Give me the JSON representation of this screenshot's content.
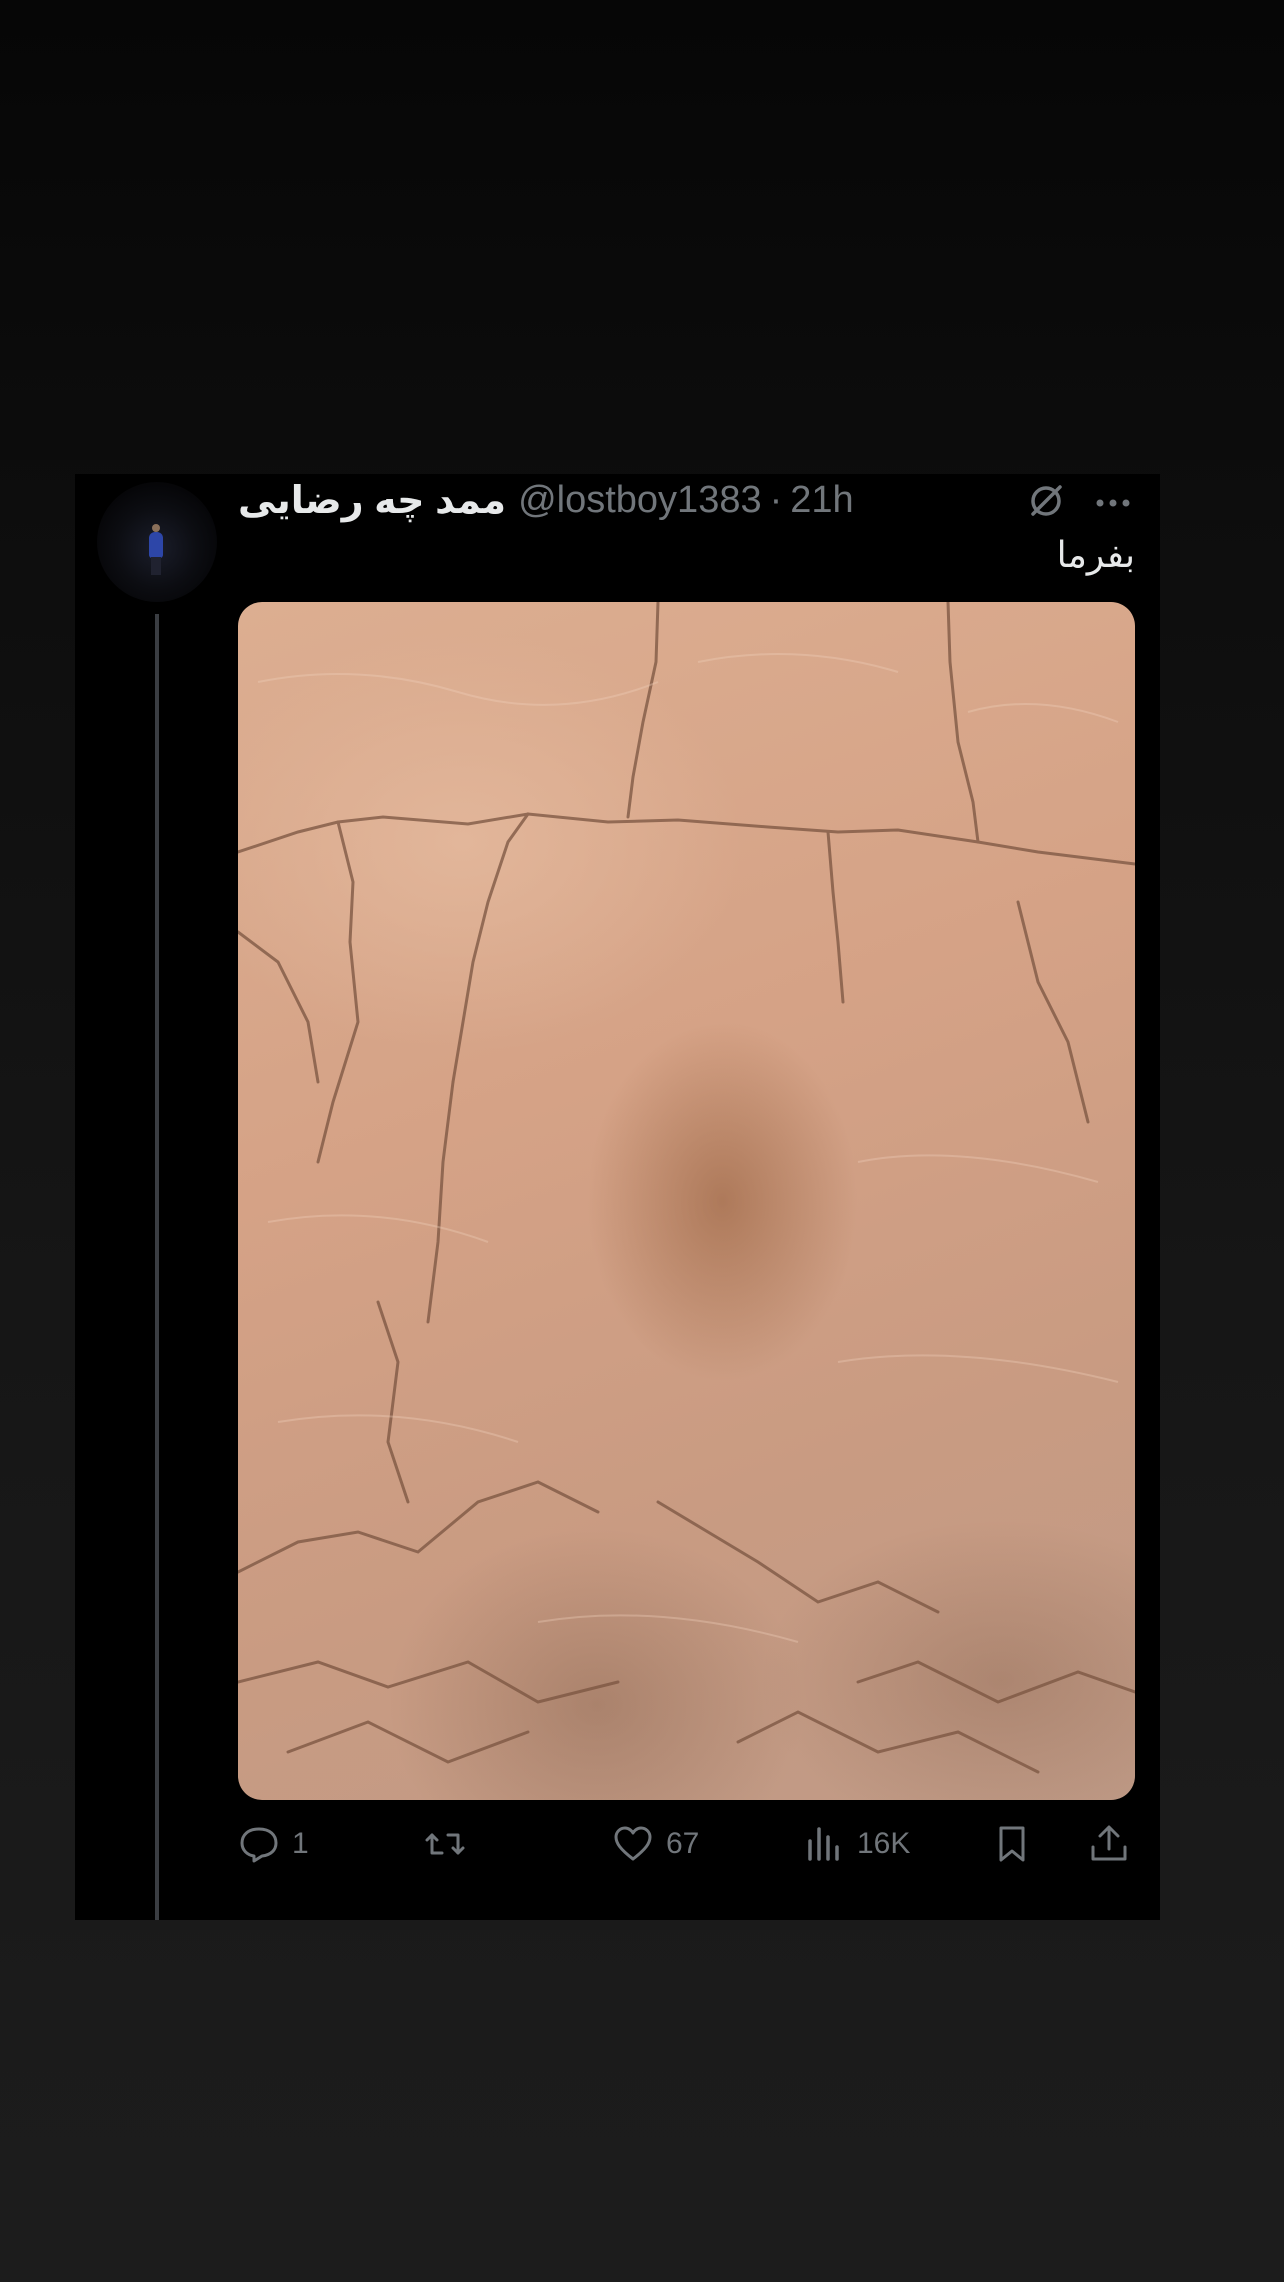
{
  "tweet": {
    "display_name": "ممد چه رضایی",
    "handle": "@lostboy1383",
    "separator": "·",
    "time": "21h",
    "text": "بفرما"
  },
  "actions": {
    "replies": "1",
    "retweets": "",
    "likes": "67",
    "views": "16K"
  },
  "icons": [
    "grok-icon",
    "more-icon",
    "reply-icon",
    "retweet-icon",
    "like-icon",
    "views-icon",
    "bookmark-icon",
    "share-icon"
  ],
  "colors": {
    "background": "#000000",
    "primary_text": "#e7e9ea",
    "secondary_text": "#71767b",
    "thread_line": "#3a3d42"
  }
}
